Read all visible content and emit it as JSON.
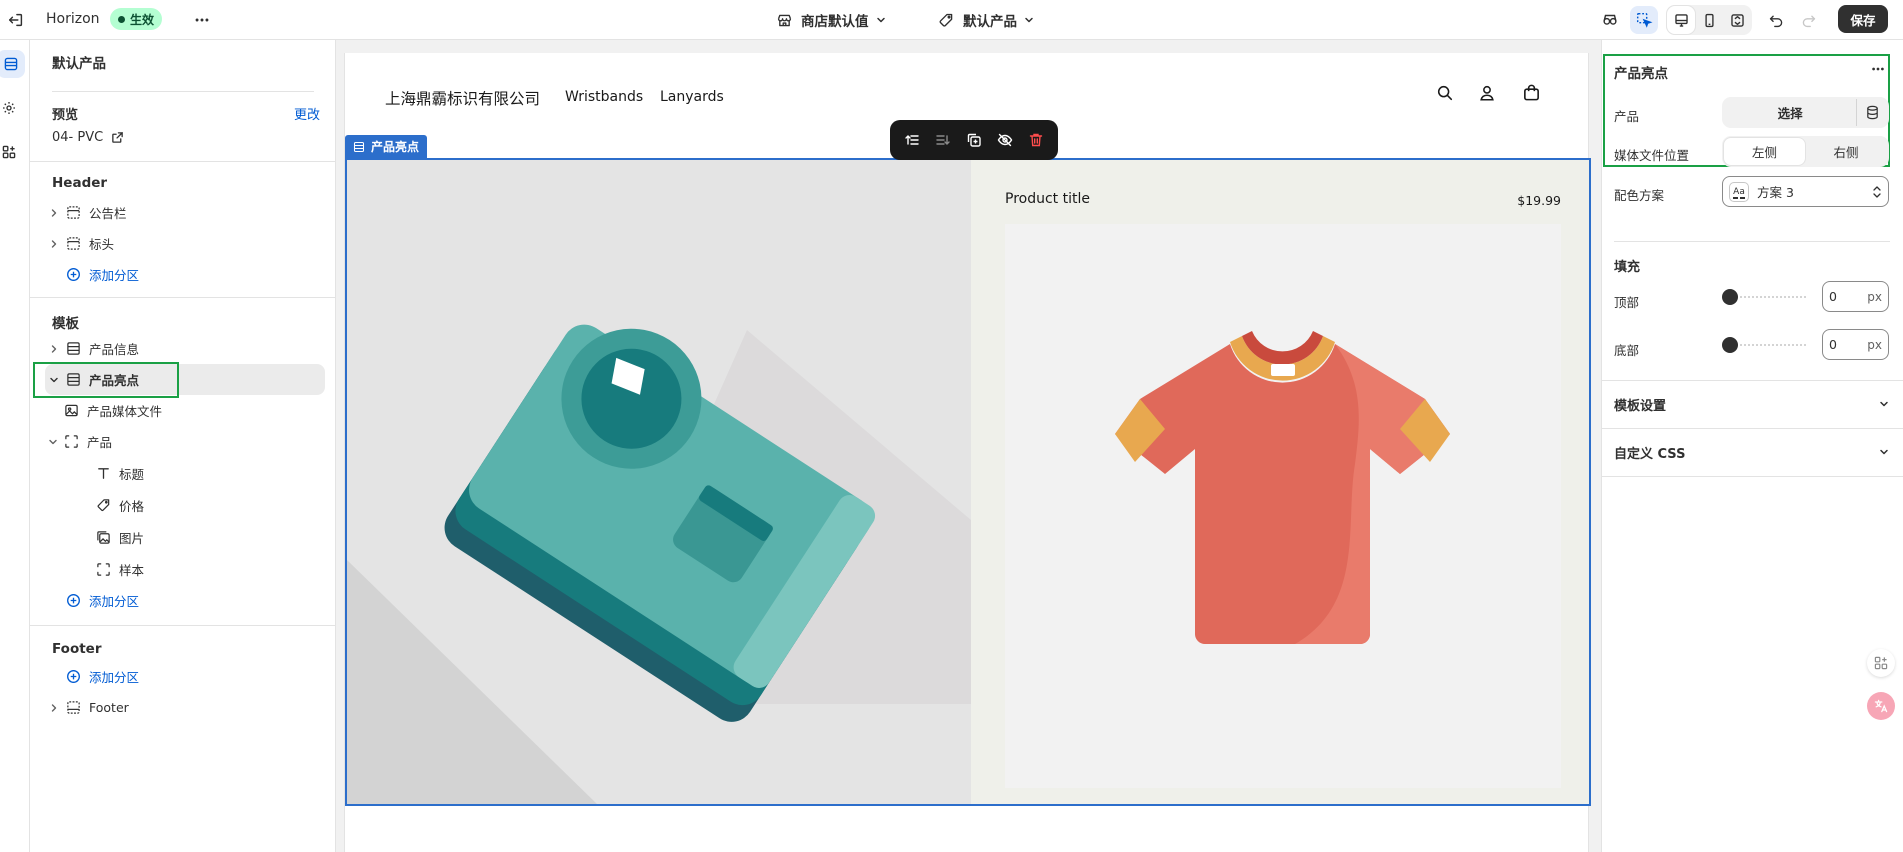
{
  "topbar": {
    "app_name": "Horizon",
    "status_badge": "生效",
    "store_default": "商店默认值",
    "default_product": "默认产品",
    "save": "保存"
  },
  "left": {
    "title": "默认产品",
    "preview_label": "预览",
    "change": "更改",
    "preview_value": "04- PVC",
    "header_title": "Header",
    "header_items": [
      "公告栏",
      "标头"
    ],
    "add_section": "添加分区",
    "template_title": "模板",
    "template_items": {
      "product_info": "产品信息",
      "highlight": "产品亮点",
      "media_file": "产品媒体文件",
      "product": "产品",
      "title": "标题",
      "price": "价格",
      "image": "图片",
      "sample": "样本"
    },
    "footer_title": "Footer",
    "footer_item": "Footer"
  },
  "preview": {
    "company": "上海鼎霸标识有限公司",
    "nav": [
      "Wristbands",
      "Lanyards"
    ],
    "section_tag": "产品亮点",
    "product_title": "Product title",
    "price": "$19.99"
  },
  "right": {
    "title": "产品亮点",
    "product_label": "产品",
    "select": "选择",
    "media_position_label": "媒体文件位置",
    "left_opt": "左侧",
    "right_opt": "右侧",
    "color_scheme_label": "配色方案",
    "color_scheme_value": "方案 3",
    "aa": "Aa",
    "padding_title": "填充",
    "top_label": "顶部",
    "top_value": "0",
    "bottom_label": "底部",
    "bottom_value": "0",
    "unit": "px",
    "template_settings": "模板设置",
    "custom_css": "自定义 CSS"
  },
  "colors": {
    "accent": "#005bd3",
    "highlight_green": "#1aa045",
    "badge_bg": "#b4fed2",
    "badge_text": "#0c5132",
    "save_bg": "#303030",
    "delete_red": "#e51c00"
  }
}
